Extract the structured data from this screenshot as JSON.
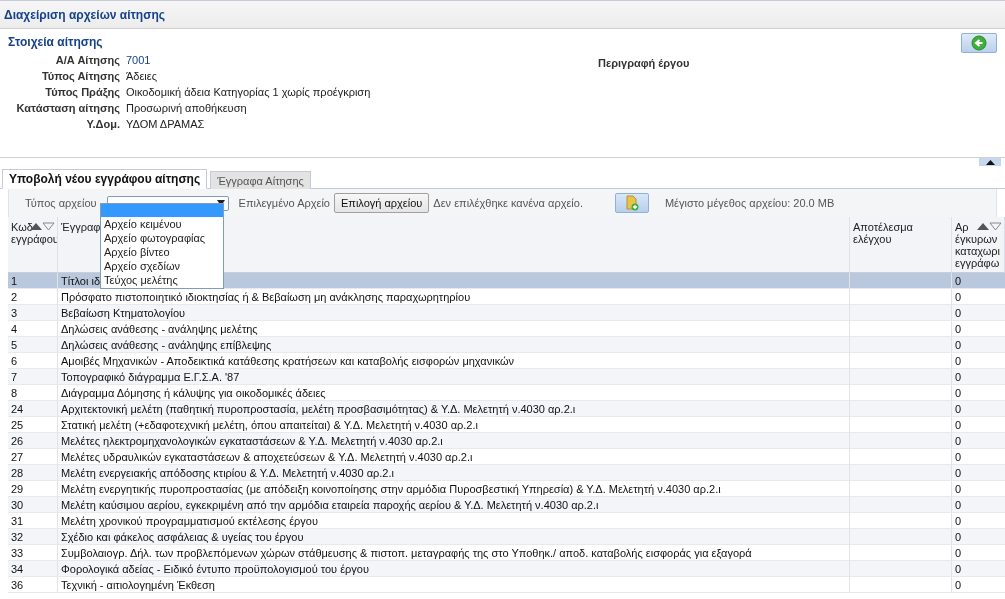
{
  "window": {
    "title": "Διαχείριση αρχείων αίτησης"
  },
  "details": {
    "heading": "Στοιχεία αίτησης",
    "fields": [
      {
        "label": "Α/Α Αίτησης",
        "value": "7001",
        "kind": "link"
      },
      {
        "label": "Τύπος Αίτησης",
        "value": "Άδειες",
        "kind": "text"
      },
      {
        "label": "Τύπος Πράξης",
        "value": "Οικοδομική άδεια Κατηγορίας 1 χωρίς προέγκριση",
        "kind": "text"
      },
      {
        "label": "Κατάσταση αίτησης",
        "value": "Προσωρινή αποθήκευση",
        "kind": "text"
      },
      {
        "label": "Υ.Δομ.",
        "value": "ΥΔΟΜ ΔΡΑΜΑΣ",
        "kind": "text"
      }
    ],
    "description_label": "Περιγραφή έργου"
  },
  "tabs": [
    {
      "label": "Υποβολή νέου εγγράφου αίτησης",
      "selected": true
    },
    {
      "label": "Έγγραφα Αίτησης",
      "selected": false
    }
  ],
  "toolbar": {
    "file_type_label": "Τύπος αρχείου",
    "selected_file_label": "Επιλεγμένο Αρχείο",
    "choose_button": "Επιλογή αρχείου",
    "no_file_text": "Δεν επιλέχθηκε κανένα αρχείο.",
    "max_size_text": "Μέγιστο μέγεθος αρχείου: 20.0 MB"
  },
  "file_type_dropdown": {
    "expanded": true,
    "options": [
      {
        "label": "Αρχείο κειμένου",
        "selected": false
      },
      {
        "label": "Αρχείο φωτογραφίας",
        "selected": false
      },
      {
        "label": "Αρχείο βίντεο",
        "selected": false
      },
      {
        "label": "Αρχείο σχεδίων",
        "selected": false
      },
      {
        "label": "Τεύχος μελέτης",
        "selected": false
      }
    ]
  },
  "table": {
    "columns": [
      {
        "label": "Κωδ",
        "label_line_2": "εγγράφου",
        "sortable": true
      },
      {
        "label": "Έγγραφ",
        "sortable": false
      },
      {
        "label": "Αποτέλεσμα ελέγχου",
        "sortable": false
      },
      {
        "label": "Αρ",
        "label_line_2": "έγκυρων καταχωρι εγγράφω",
        "sortable": true
      }
    ],
    "rows": [
      {
        "code": "1",
        "document": "Τίτλοι ιδ",
        "result": "",
        "count": "0",
        "selected": true
      },
      {
        "code": "2",
        "document": "Πρόσφατο πιστοποιητικό ιδιοκτησίας ή & Βεβαίωση μη ανάκλησης παραχωρητηρίου",
        "count": "0",
        "selected": false
      },
      {
        "code": "3",
        "document": "Βεβαίωση Κτηματολογίου",
        "count": "0",
        "selected": false
      },
      {
        "code": "4",
        "document": "Δηλώσεις ανάθεσης - ανάληψης μελέτης",
        "count": "0",
        "selected": false
      },
      {
        "code": "5",
        "document": "Δηλώσεις ανάθεσης - ανάληψης επίβλεψης",
        "count": "0",
        "selected": false
      },
      {
        "code": "6",
        "document": "Αμοιβές Μηχανικών - Αποδεικτικά κατάθεσης κρατήσεων και καταβολής εισφορών μηχανικών",
        "count": "0",
        "selected": false
      },
      {
        "code": "7",
        "document": "Τοπογραφικό διάγραμμα Ε.Γ.Σ.Α. '87",
        "count": "0",
        "selected": false
      },
      {
        "code": "8",
        "document": "Διάγραμμα Δόμησης ή κάλυψης για οικοδομικές άδειες",
        "count": "0",
        "selected": false
      },
      {
        "code": "24",
        "document": "Αρχιτεκτονική μελέτη (παθητική πυροπροστασία, μελέτη προσβασιμότητας) & Υ.Δ. Μελετητή ν.4030 αρ.2.ι",
        "count": "0",
        "selected": false
      },
      {
        "code": "25",
        "document": "Στατική μελέτη (+εδαφοτεχνική μελέτη, όπου απαιτείται) & Υ.Δ. Μελετητή ν.4030 αρ.2.ι",
        "count": "0",
        "selected": false
      },
      {
        "code": "26",
        "document": "Μελέτες ηλεκτρομηχανολογικών εγκαταστάσεων & Υ.Δ. Μελετητή ν.4030 αρ.2.ι",
        "count": "0",
        "selected": false
      },
      {
        "code": "27",
        "document": "Μελέτες υδραυλικών εγκαταστάσεων & αποχετεύσεων & Υ.Δ. Μελετητή ν.4030 αρ.2.ι",
        "count": "0",
        "selected": false
      },
      {
        "code": "28",
        "document": "Μελέτη ενεργειακής απόδοσης κτιρίου & Υ.Δ. Μελετητή ν.4030 αρ.2.ι",
        "count": "0",
        "selected": false
      },
      {
        "code": "29",
        "document": "Μελέτη ενεργητικής πυροπροστασίας (με απόδειξη κοινοποίησης στην αρμόδια Πυροσβεστική Υπηρεσία) & Υ.Δ. Μελετητή ν.4030 αρ.2.ι",
        "count": "0",
        "selected": false
      },
      {
        "code": "30",
        "document": "Μελέτη καύσιμου αερίου, εγκεκριμένη από την αρμόδια εταιρεία παροχής αερίου & Υ.Δ. Μελετητή ν.4030 αρ.2.ι",
        "count": "0",
        "selected": false
      },
      {
        "code": "31",
        "document": "Μελέτη χρονικού προγραμματισμού εκτέλεσης έργου",
        "count": "0",
        "selected": false
      },
      {
        "code": "32",
        "document": "Σχέδιο και φάκελος ασφάλειας & υγείας του έργου",
        "count": "0",
        "selected": false
      },
      {
        "code": "33",
        "document": "Συμβολαιογρ. Δήλ. των προβλεπόμενων χώρων στάθμευσης & πιστοπ. μεταγραφής της στο Υποθηκ./ αποδ. καταβολής εισφοράς για εξαγορά",
        "count": "0",
        "selected": false
      },
      {
        "code": "34",
        "document": "Φορολογικά αδείας - Ειδικό έντυπο προϋπολογισμού του έργου",
        "count": "0",
        "selected": false
      },
      {
        "code": "36",
        "document": "Τεχνική - αιτιολογημένη Έκθεση",
        "count": "0",
        "selected": false
      }
    ]
  }
}
